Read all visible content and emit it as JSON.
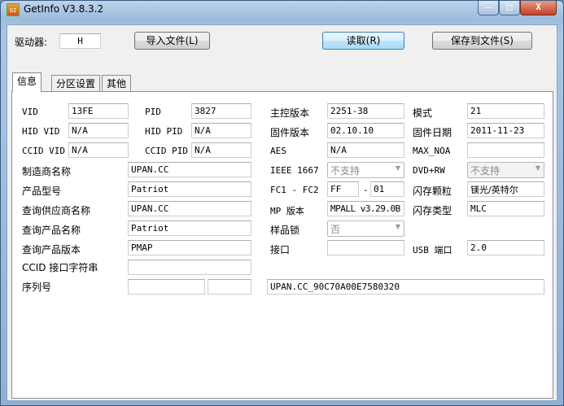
{
  "window": {
    "title": "GetInfo V3.8.3.2",
    "app_icon": "getinfo-icon",
    "controls": {
      "minimize": "—",
      "maximize": "□",
      "close": "X"
    }
  },
  "toolbar": {
    "drive_label": "驱动器:",
    "drive_value": "H",
    "import_label": "导入文件(L)",
    "read_label": "读取(R)",
    "save_label": "保存到文件(S)"
  },
  "tabs": [
    {
      "label": "信息",
      "selected": true
    },
    {
      "label": "分区设置"
    },
    {
      "label": "其他"
    }
  ],
  "info": {
    "vid": {
      "label": "VID",
      "value": "13FE"
    },
    "pid": {
      "label": "PID",
      "value": "3827"
    },
    "hid_vid": {
      "label": "HID VID",
      "value": "N/A"
    },
    "hid_pid": {
      "label": "HID PID",
      "value": "N/A"
    },
    "ccid_vid": {
      "label": "CCID VID",
      "value": "N/A"
    },
    "ccid_pid": {
      "label": "CCID PID",
      "value": "N/A"
    },
    "manufacturer": {
      "label": "制造商名称",
      "value": "UPAN.CC"
    },
    "product_model": {
      "label": "产品型号",
      "value": "Patriot"
    },
    "query_vendor": {
      "label": "查询供应商名称",
      "value": "UPAN.CC"
    },
    "query_product": {
      "label": "查询产品名称",
      "value": "Patriot"
    },
    "query_version": {
      "label": "查询产品版本",
      "value": "PMAP"
    },
    "ccid_string": {
      "label": "CCID 接口字符串",
      "value": ""
    },
    "serial": {
      "label": "序列号",
      "value1": "",
      "value2": "",
      "value3": "UPAN.CC_90C70A00E7580320"
    },
    "controller": {
      "label": "主控版本",
      "value": "2251-38"
    },
    "mode": {
      "label": "模式",
      "value": "21"
    },
    "firmware": {
      "label": "固件版本",
      "value": "02.10.10"
    },
    "firmware_date": {
      "label": "固件日期",
      "value": "2011-11-23"
    },
    "aes": {
      "label": "AES",
      "value": "N/A"
    },
    "max_noa": {
      "label": "MAX_NOA",
      "value": ""
    },
    "ieee1667": {
      "label": "IEEE 1667",
      "value": "不支持"
    },
    "dvdrw": {
      "label": "DVD+RW",
      "value": "不支持"
    },
    "fc": {
      "label": "FC1 - FC2",
      "value1": "FF",
      "sep": "-",
      "value2": "01"
    },
    "flash_chip": {
      "label": "闪存颗粒",
      "value": "镁光/英特尔"
    },
    "mp_version": {
      "label": "MP 版本",
      "value": "MPALL v3.29.0B"
    },
    "flash_type": {
      "label": "闪存类型",
      "value": "MLC"
    },
    "sample_lock": {
      "label": "样品锁",
      "value": "否"
    },
    "interface": {
      "label": "接口",
      "value": ""
    },
    "usb_port": {
      "label": "USB 端口",
      "value": "2.0"
    }
  }
}
